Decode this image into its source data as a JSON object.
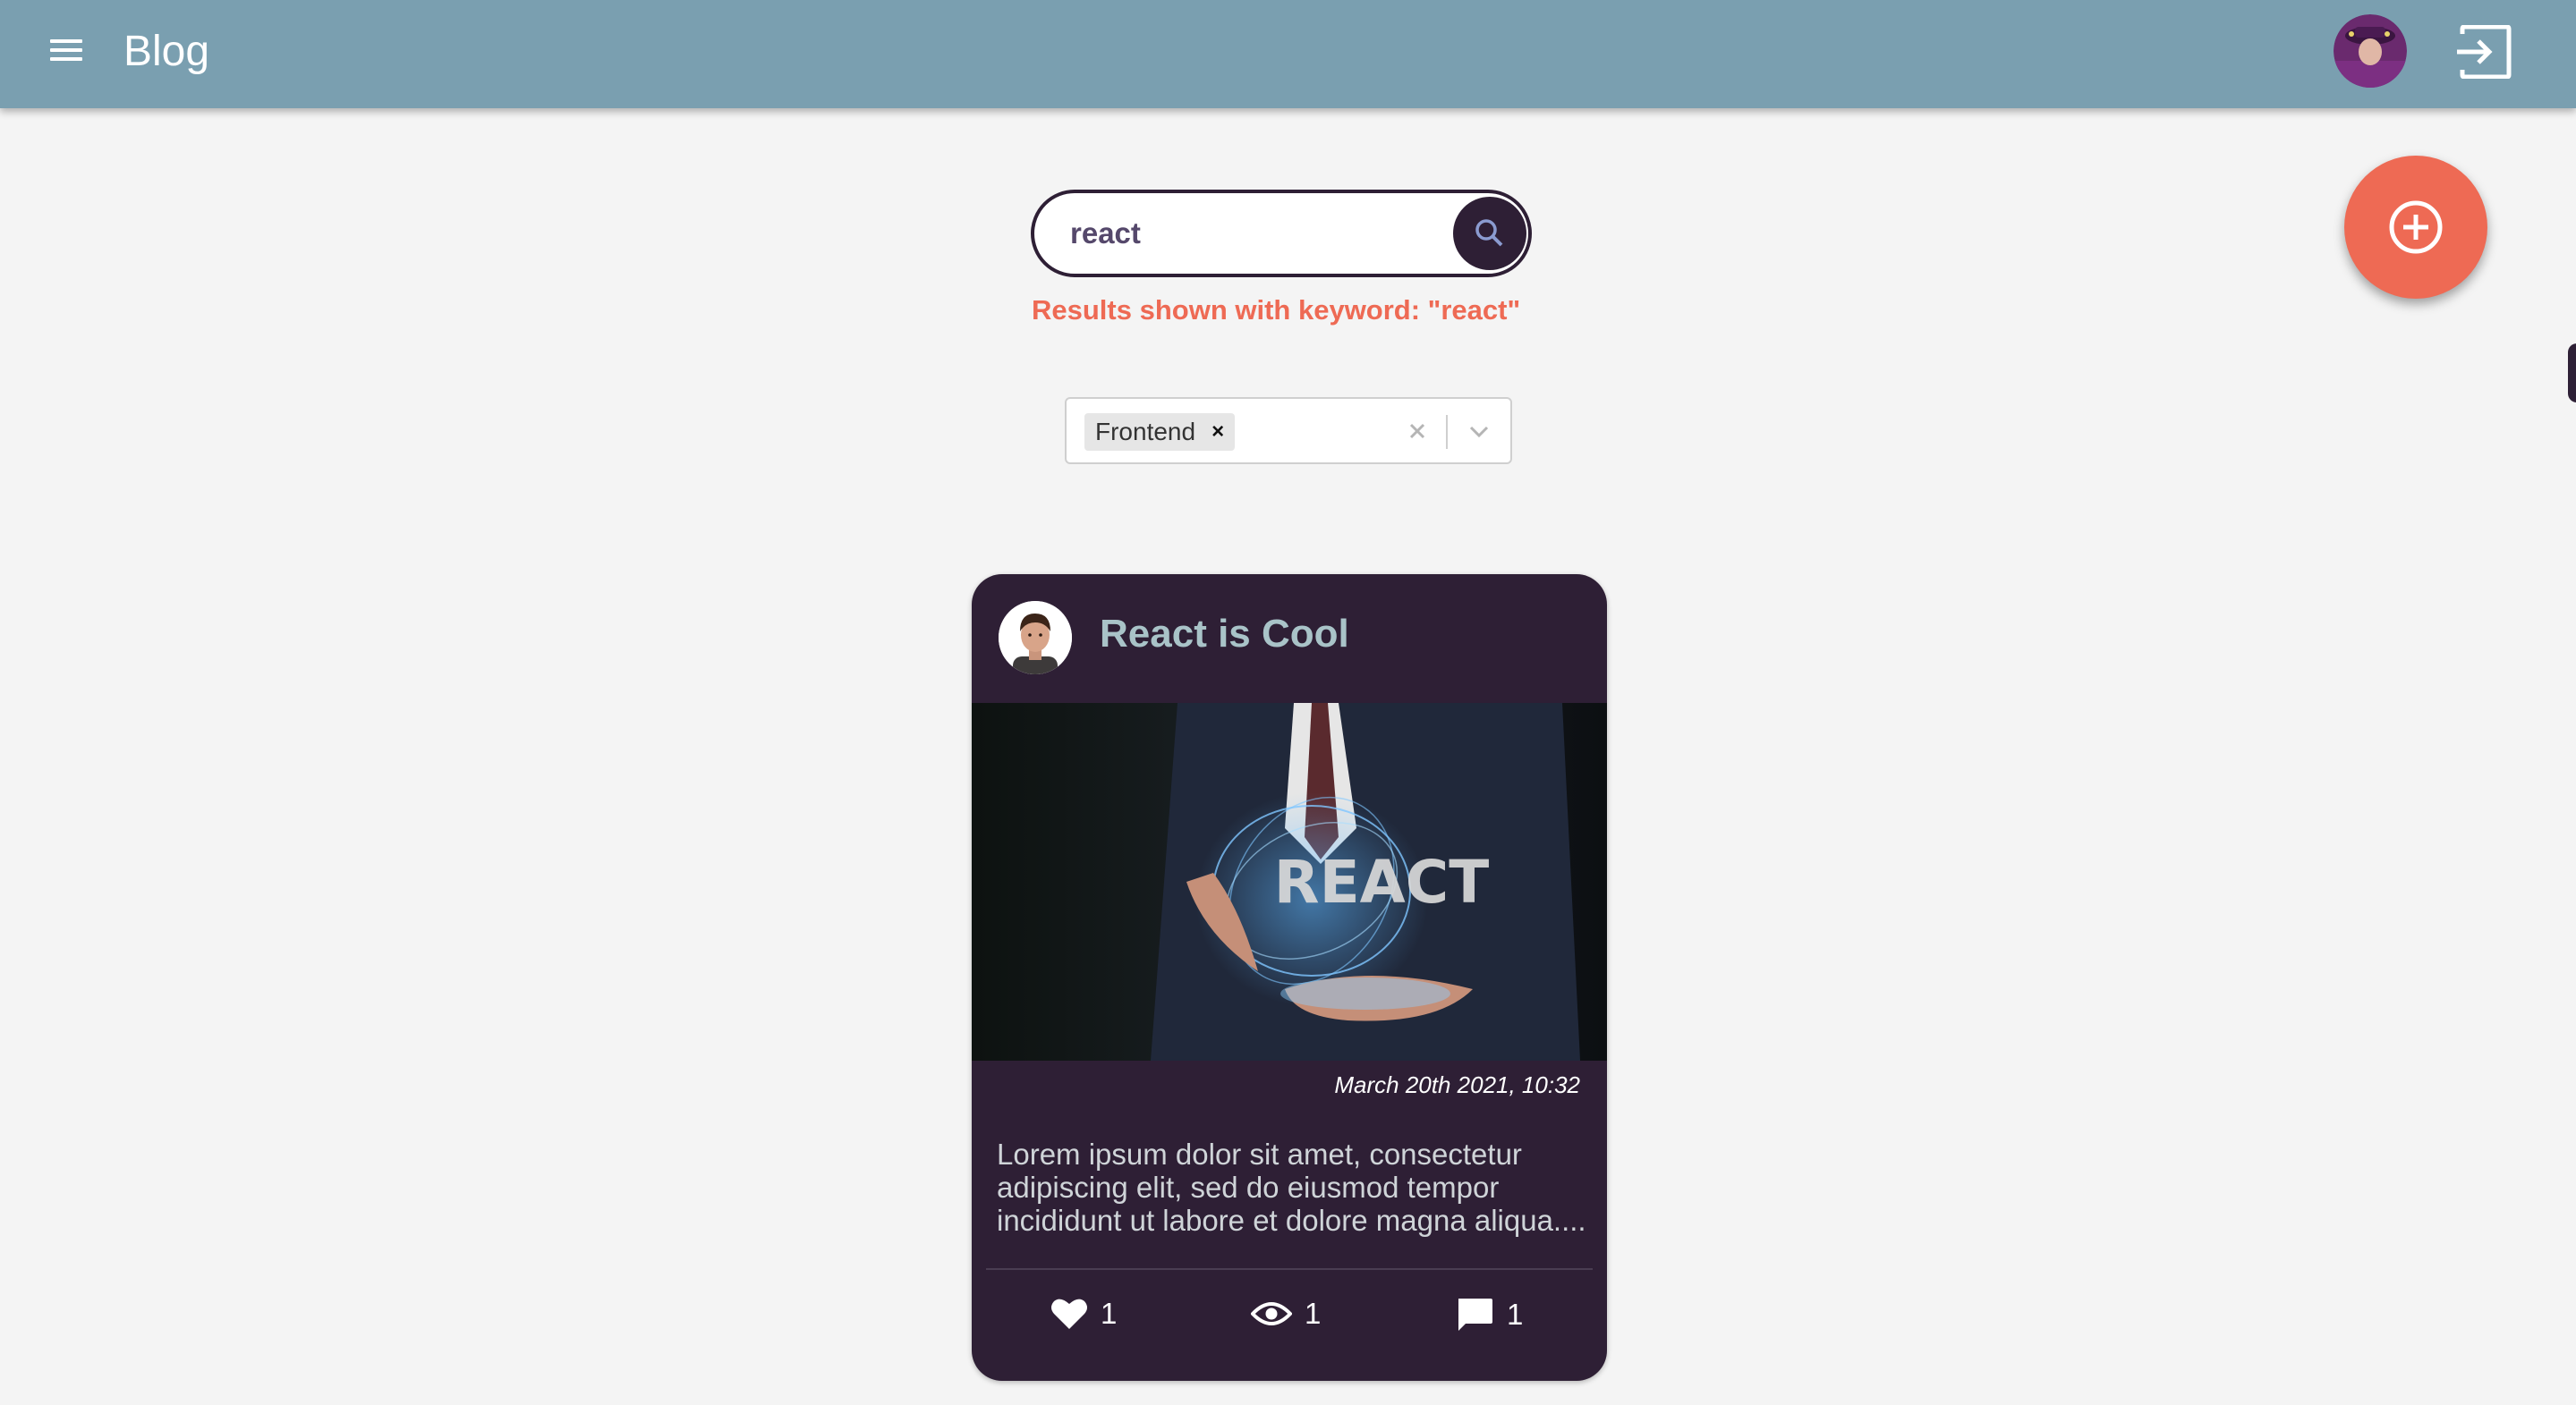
{
  "app": {
    "title": "Blog",
    "accent_color": "#7a9fb0",
    "fab_color": "#ee6a54",
    "card_color": "#2e1f35"
  },
  "header": {
    "menu_icon": "hamburger-menu-icon",
    "logout_icon": "logout-icon"
  },
  "search": {
    "value": "react",
    "button_icon": "search-icon"
  },
  "results_message": "Results shown with keyword: \"react\"",
  "filter": {
    "selected_tags": [
      "Frontend"
    ],
    "chip_remove": "×"
  },
  "post": {
    "title": "React is Cool",
    "image_text": "REACT",
    "date": "March 20th 2021, 10:32",
    "excerpt": "Lorem ipsum dolor sit amet, consectetur adipiscing elit, sed do eiusmod tempor incididunt ut labore et dolore magna aliqua....",
    "likes": "1",
    "views": "1",
    "comments": "1"
  }
}
